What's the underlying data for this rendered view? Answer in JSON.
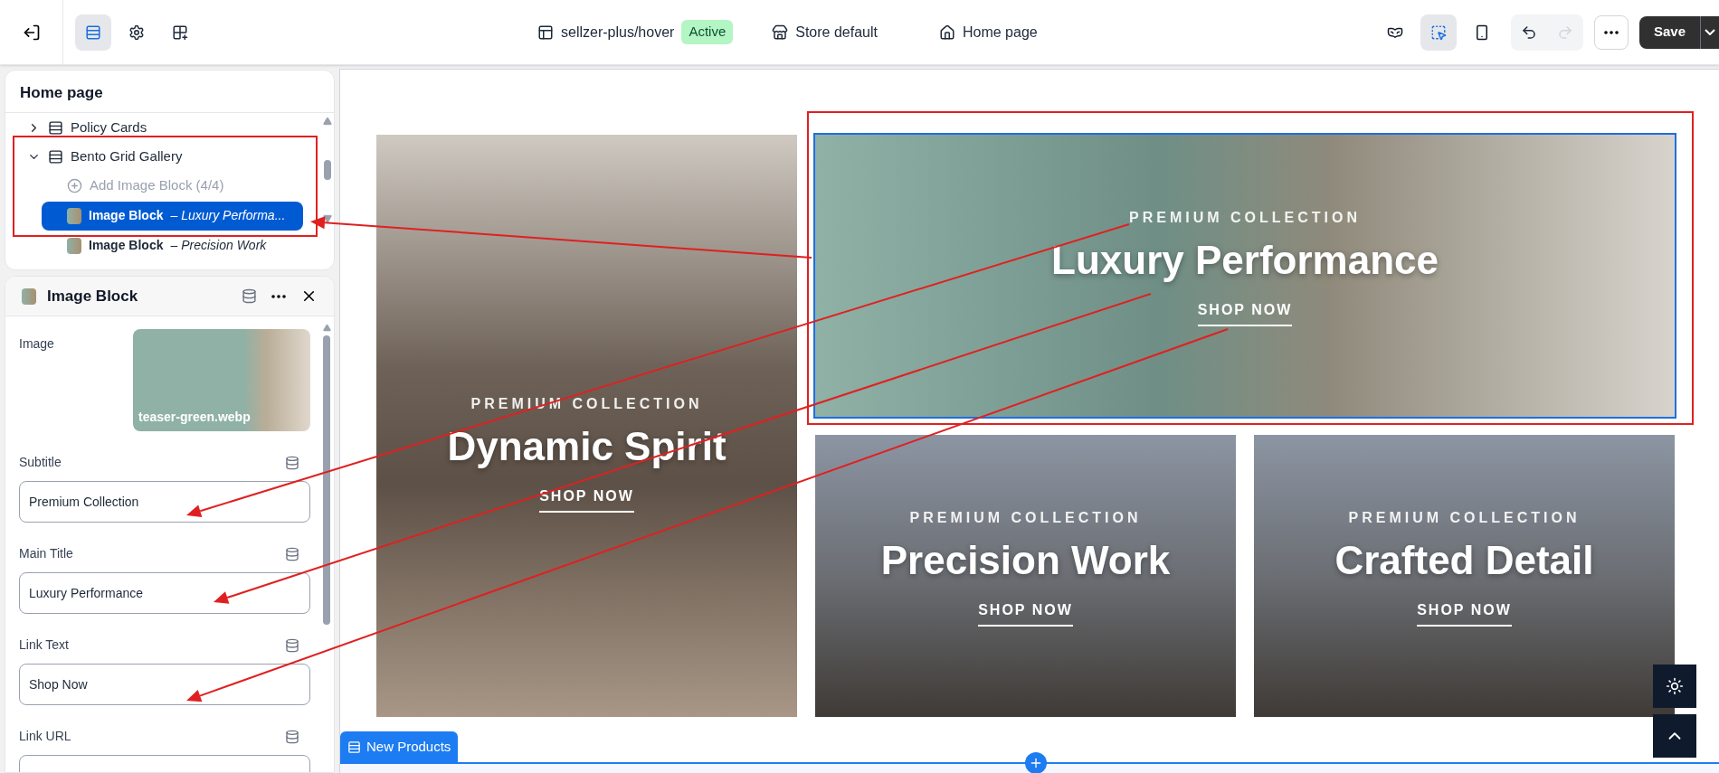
{
  "topbar": {
    "left_tools": [
      {
        "kind": "sections",
        "selected": true
      },
      {
        "kind": "settings",
        "selected": false
      },
      {
        "kind": "apps",
        "selected": false
      }
    ],
    "theme": "sellzer-plus/hover",
    "status": "Active",
    "store": "Store default",
    "page": "Home page",
    "right_tools": [
      {
        "kind": "preview",
        "selected": false
      },
      {
        "kind": "inspect",
        "selected": true
      },
      {
        "kind": "mobile",
        "selected": false
      }
    ],
    "undo": {
      "disabled": false
    },
    "redo": {
      "disabled": true
    },
    "save": "Save"
  },
  "layers": {
    "title": "Home page",
    "items": [
      {
        "kind": "section",
        "label": "Policy Cards",
        "expanded": false
      },
      {
        "kind": "section",
        "label": "Bento Grid Gallery",
        "expanded": true,
        "children": [
          {
            "kind": "add",
            "label": "Add Image Block (4/4)",
            "disabled": true
          },
          {
            "kind": "block",
            "label": "Image Block",
            "detail": "– Luxury Performa...",
            "selected": true
          },
          {
            "kind": "block",
            "label": "Image Block",
            "detail": "– Precision Work",
            "selected": false
          }
        ]
      }
    ]
  },
  "inspector": {
    "title": "Image Block",
    "image_label": "Image",
    "file_name": "teaser-green.webp",
    "fields": [
      {
        "label": "Subtitle",
        "value": "Premium Collection"
      },
      {
        "label": "Main Title",
        "value": "Luxury Performance"
      },
      {
        "label": "Link Text",
        "value": "Shop Now"
      },
      {
        "label": "Link URL"
      }
    ]
  },
  "canvas": {
    "tiles": [
      {
        "kind": "tall",
        "subtitle": "PREMIUM COLLECTION",
        "title": "Dynamic Spirit",
        "link": "SHOP NOW",
        "selected": false
      },
      {
        "kind": "wide",
        "subtitle": "PREMIUM COLLECTION",
        "title": "Luxury Performance",
        "link": "SHOP NOW",
        "selected": true
      },
      {
        "kind": "small",
        "subtitle": "PREMIUM COLLECTION",
        "title": "Precision Work",
        "link": "SHOP NOW",
        "selected": false
      },
      {
        "kind": "small",
        "subtitle": "PREMIUM COLLECTION",
        "title": "Crafted Detail",
        "link": "SHOP NOW",
        "selected": false
      }
    ],
    "section_tab": "New Products"
  }
}
